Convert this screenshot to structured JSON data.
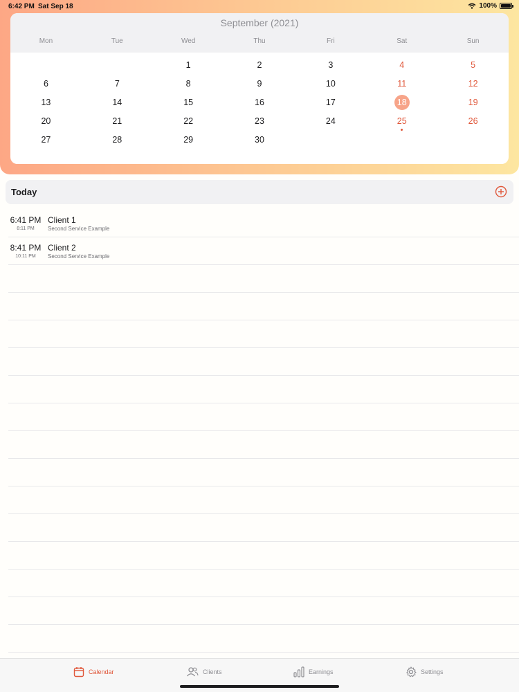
{
  "status_bar": {
    "time": "6:42 PM",
    "date": "Sat Sep 18",
    "battery": "100%"
  },
  "calendar": {
    "month_title": "September (2021)",
    "weekdays": [
      "Mon",
      "Tue",
      "Wed",
      "Thu",
      "Fri",
      "Sat",
      "Sun"
    ],
    "weeks": [
      [
        "",
        "",
        "1",
        "2",
        "3",
        "4",
        "5"
      ],
      [
        "6",
        "7",
        "8",
        "9",
        "10",
        "11",
        "12"
      ],
      [
        "13",
        "14",
        "15",
        "16",
        "17",
        "18",
        "19"
      ],
      [
        "20",
        "21",
        "22",
        "23",
        "24",
        "25",
        "26"
      ],
      [
        "27",
        "28",
        "29",
        "30",
        "",
        "",
        ""
      ]
    ],
    "selected_day": "18",
    "event_dot_day": "25",
    "accent_color": "#e0573a"
  },
  "today": {
    "title": "Today",
    "add_icon": "plus-circle-icon"
  },
  "appointments": [
    {
      "start": "6:41 PM",
      "end": "8:11 PM",
      "client": "Client 1",
      "service": "Second Service Example"
    },
    {
      "start": "8:41 PM",
      "end": "10:11 PM",
      "client": "Client 2",
      "service": "Second Service Example"
    }
  ],
  "empty_rows": 14,
  "tabs": [
    {
      "label": "Calendar",
      "icon": "calendar-icon",
      "active": true
    },
    {
      "label": "Clients",
      "icon": "people-icon",
      "active": false
    },
    {
      "label": "Earnings",
      "icon": "bar-chart-icon",
      "active": false
    },
    {
      "label": "Settings",
      "icon": "gear-icon",
      "active": false
    }
  ]
}
